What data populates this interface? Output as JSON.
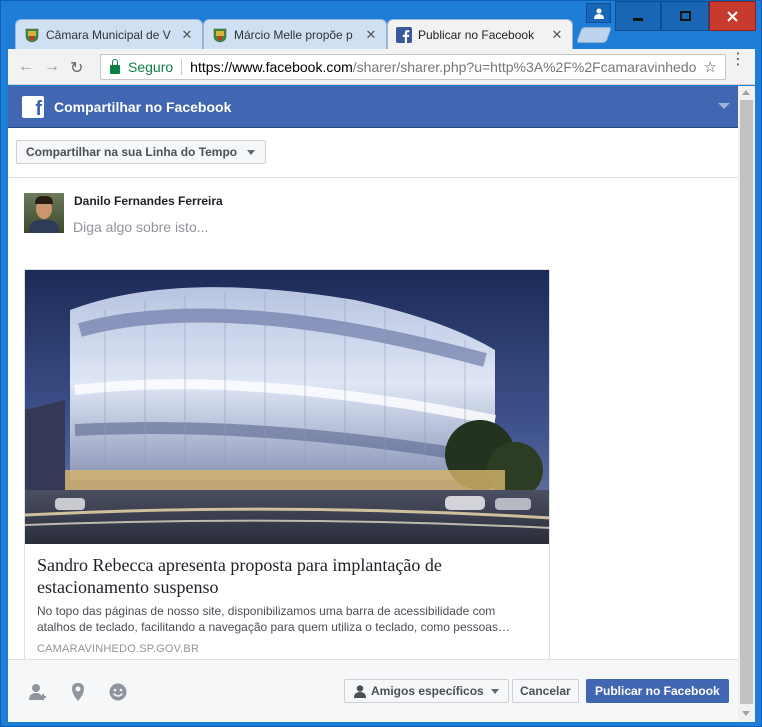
{
  "browser": {
    "tabs": [
      {
        "label": "Câmara Municipal de V",
        "close": "✕"
      },
      {
        "label": "Márcio Melle propõe p",
        "close": "✕"
      },
      {
        "label": "Publicar no Facebook",
        "close": "✕"
      }
    ],
    "secure_label": "Seguro",
    "url_host": "https://www.facebook.com",
    "url_rest": "/sharer/sharer.php?u=http%3A%2F%2Fcamaravinhedo"
  },
  "dialog": {
    "header_title": "Compartilhar no Facebook",
    "share_target": "Compartilhar na sua Linha do Tempo",
    "user_name": "Danilo Fernandes Ferreira",
    "post_placeholder": "Diga algo sobre isto...",
    "link": {
      "title": "Sandro Rebecca apresenta proposta para implantação de estacionamento suspenso",
      "description": "No topo das páginas de nosso site, disponibilizamos uma barra de acessibilidade com atalhos de teclado, facilitando a navegação para quem utiliza o teclado, como pessoas…",
      "domain": "CAMARAVINHEDO.SP.GOV.BR"
    },
    "footer": {
      "audience_label": "Amigos específicos",
      "cancel_label": "Cancelar",
      "publish_label": "Publicar no Facebook"
    }
  },
  "colors": {
    "facebook_blue": "#4267b2",
    "window_blue": "#1e7dd6",
    "secure_green": "#0b8043"
  }
}
